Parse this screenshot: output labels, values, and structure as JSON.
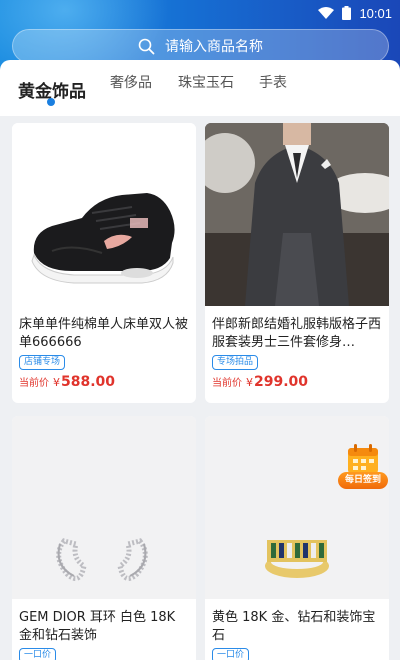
{
  "status_bar": {
    "time": "10:01",
    "wifi_icon": "wifi-icon",
    "battery_icon": "battery-icon"
  },
  "search": {
    "placeholder": "请输入商品名称",
    "icon": "search-icon"
  },
  "tabs": [
    {
      "label": "黄金饰品",
      "active": true
    },
    {
      "label": "奢侈品",
      "active": false
    },
    {
      "label": "珠宝玉石",
      "active": false
    },
    {
      "label": "手表",
      "active": false
    }
  ],
  "products": [
    {
      "title": "床单单件纯棉单人床单双人被单666666",
      "badge": "店铺专场",
      "price_label": "当前价",
      "currency": "¥",
      "price": "588.00",
      "image": "sneaker-image"
    },
    {
      "title": "伴郎新郎结婚礼服韩版格子西服套装男士三件套修身…",
      "badge": "专场拍品",
      "price_label": "当前价",
      "currency": "¥",
      "price": "299.00",
      "image": "suit-image"
    },
    {
      "title": "GEM DIOR 耳环 白色 18K 金和钻石装饰",
      "badge": "一口价",
      "image": "earrings-image"
    },
    {
      "title": "黄色 18K 金、钻石和装饰宝石",
      "badge": "一口价",
      "image": "ring-image"
    }
  ],
  "checkin": {
    "label": "每日签到",
    "icon": "calendar-icon"
  },
  "colors": {
    "accent": "#1a7fe0",
    "price": "#e0342c",
    "badge": "#2a8be8"
  }
}
